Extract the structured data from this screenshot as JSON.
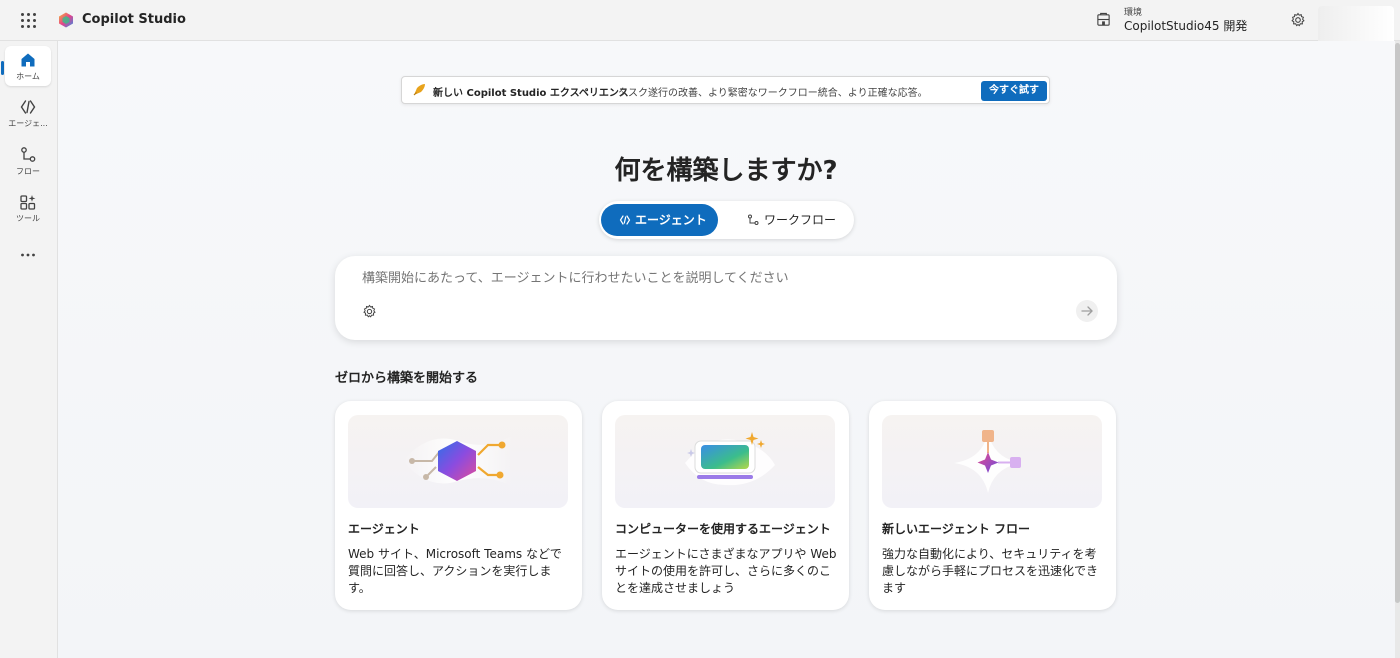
{
  "app": {
    "name": "Copilot Studio",
    "environment_label": "環境",
    "environment_name": "CopilotStudio45 開発"
  },
  "rail": {
    "items": [
      {
        "label": "ホーム",
        "icon": "home-icon",
        "active": true
      },
      {
        "label": "エージェ...",
        "icon": "agent-icon"
      },
      {
        "label": "フロー",
        "icon": "flow-icon"
      },
      {
        "label": "ツール",
        "icon": "tools-icon"
      }
    ],
    "more_icon": "more-icon"
  },
  "banner": {
    "title": "新しい Copilot Studio エクスペリエンス",
    "description": "タスク遂行の改善、より緊密なワークフロー統合、より正確な応答。",
    "button": "今すぐ試す"
  },
  "heading": "何を構築しますか?",
  "toggle": {
    "agent_label": "エージェント",
    "flow_label": "ワークフロー",
    "selected": "agent"
  },
  "prompt": {
    "placeholder": "構築開始にあたって、エージェントに行わせたいことを説明してください"
  },
  "section_title": "ゼロから構築を開始する",
  "cards": [
    {
      "title": "エージェント",
      "description": "Web サイト、Microsoft Teams などで質問に回答し、アクションを実行します。"
    },
    {
      "title": "コンピューターを使用するエージェント",
      "description": "エージェントにさまざまなアプリや Web サイトの使用を許可し、さらに多くのことを達成させましょう"
    },
    {
      "title": "新しいエージェント フロー",
      "description": "強力な自動化により、セキュリティを考慮しながら手軽にプロセスを迅速化できます"
    }
  ],
  "colors": {
    "accent": "#0f6cbd",
    "background": "#f5f5f7",
    "card": "#ffffff"
  }
}
